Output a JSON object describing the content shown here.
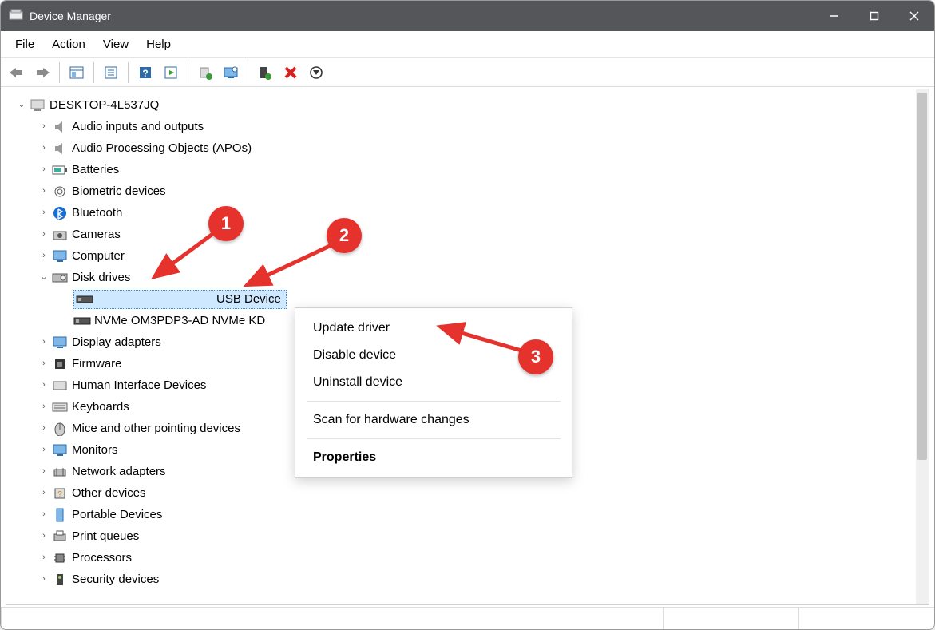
{
  "window": {
    "title": "Device Manager"
  },
  "menubar": [
    "File",
    "Action",
    "View",
    "Help"
  ],
  "tree": {
    "root": "DESKTOP-4L537JQ",
    "items": [
      {
        "label": "Audio inputs and outputs",
        "expandable": true
      },
      {
        "label": "Audio Processing Objects (APOs)",
        "expandable": true
      },
      {
        "label": "Batteries",
        "expandable": true
      },
      {
        "label": "Biometric devices",
        "expandable": true
      },
      {
        "label": "Bluetooth",
        "expandable": true
      },
      {
        "label": "Cameras",
        "expandable": true
      },
      {
        "label": "Computer",
        "expandable": true
      },
      {
        "label": "Disk drives",
        "expandable": true,
        "expanded": true,
        "children": [
          {
            "label": "USB Device",
            "selected": true
          },
          {
            "label": "NVMe OM3PDP3-AD NVMe KD"
          }
        ]
      },
      {
        "label": "Display adapters",
        "expandable": true
      },
      {
        "label": "Firmware",
        "expandable": true
      },
      {
        "label": "Human Interface Devices",
        "expandable": true
      },
      {
        "label": "Keyboards",
        "expandable": true
      },
      {
        "label": "Mice and other pointing devices",
        "expandable": true
      },
      {
        "label": "Monitors",
        "expandable": true
      },
      {
        "label": "Network adapters",
        "expandable": true
      },
      {
        "label": "Other devices",
        "expandable": true
      },
      {
        "label": "Portable Devices",
        "expandable": true
      },
      {
        "label": "Print queues",
        "expandable": true
      },
      {
        "label": "Processors",
        "expandable": true
      },
      {
        "label": "Security devices",
        "expandable": true
      }
    ]
  },
  "context_menu": {
    "items": [
      {
        "label": "Update driver"
      },
      {
        "label": "Disable device"
      },
      {
        "label": "Uninstall device"
      },
      {
        "sep": true
      },
      {
        "label": "Scan for hardware changes"
      },
      {
        "sep": true
      },
      {
        "label": "Properties",
        "bold": true
      }
    ]
  },
  "annotations": {
    "1": "1",
    "2": "2",
    "3": "3"
  }
}
